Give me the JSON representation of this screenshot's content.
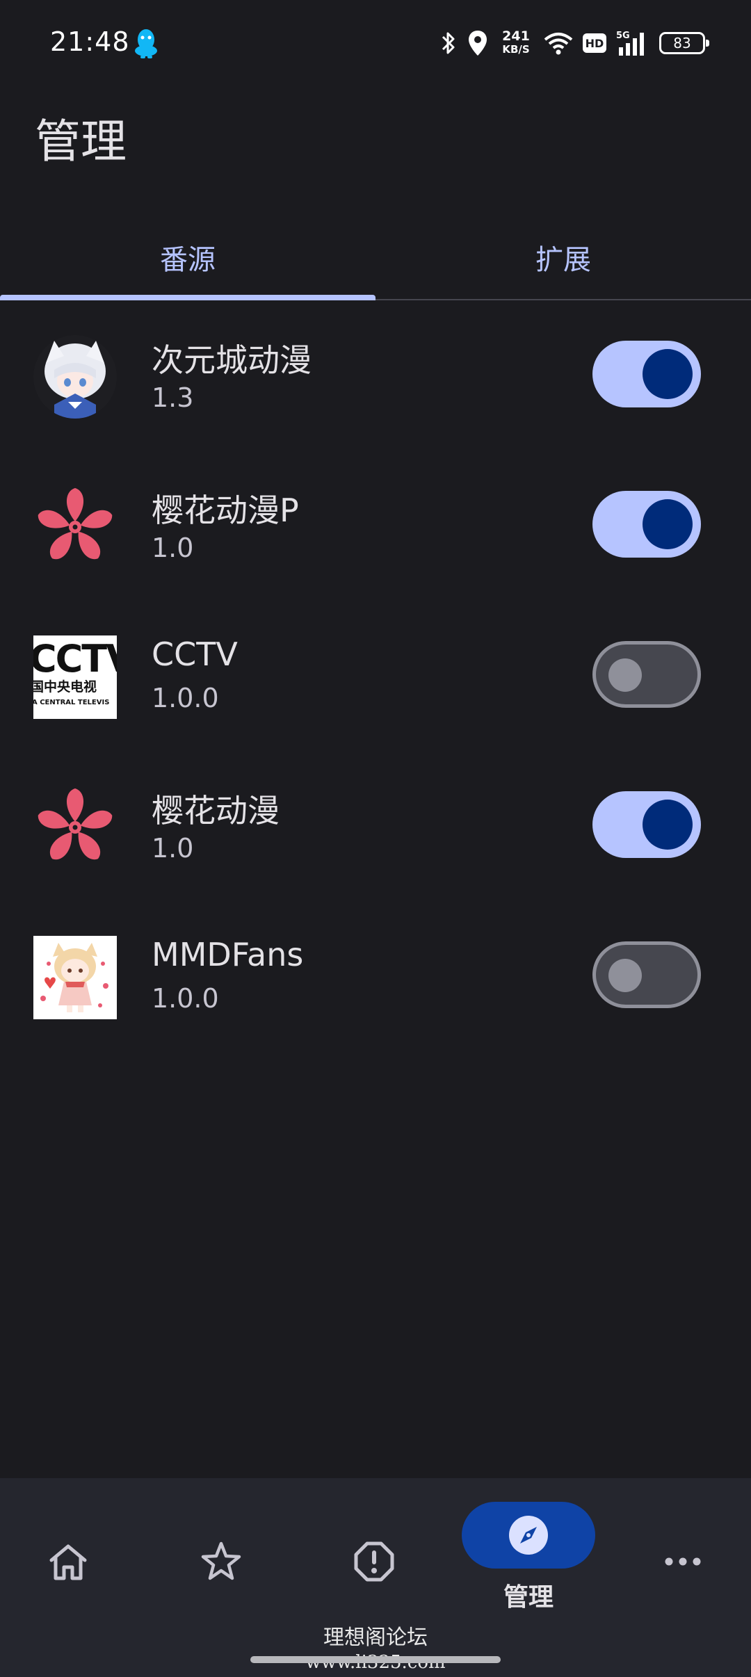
{
  "status_bar": {
    "time": "21:48",
    "net_speed": "241",
    "net_speed_unit": "KB/S",
    "hd": "HD",
    "signal_label": "5G",
    "battery": "83"
  },
  "header": {
    "title": "管理"
  },
  "tabs": [
    {
      "label": "番源",
      "active": true
    },
    {
      "label": "扩展",
      "active": false
    }
  ],
  "sources": [
    {
      "name": "次元城动漫",
      "version": "1.3",
      "enabled": true,
      "icon": "anime-girl-avatar"
    },
    {
      "name": "樱花动漫P",
      "version": "1.0",
      "enabled": true,
      "icon": "sakura-flower-icon"
    },
    {
      "name": "CCTV",
      "version": "1.0.0",
      "enabled": false,
      "icon": "cctv-logo",
      "logo_text": [
        "CCTV",
        "国中央电视",
        "A CENTRAL TELEVIS"
      ]
    },
    {
      "name": "樱花动漫",
      "version": "1.0",
      "enabled": true,
      "icon": "sakura-flower-icon"
    },
    {
      "name": "MMDFans",
      "version": "1.0.0",
      "enabled": false,
      "icon": "chibi-girl-avatar"
    }
  ],
  "bottom_nav": {
    "items": [
      "home-icon",
      "star-icon",
      "alert-icon",
      "compass-icon",
      "more-icon"
    ],
    "active_label": "管理"
  },
  "watermark": {
    "line1": "理想阁论坛",
    "line2": "www.li325.com"
  },
  "colors": {
    "background": "#1b1b1f",
    "accent": "#b6c4ff",
    "accent_dark": "#002b7a",
    "nav_bg": "#25262e"
  }
}
